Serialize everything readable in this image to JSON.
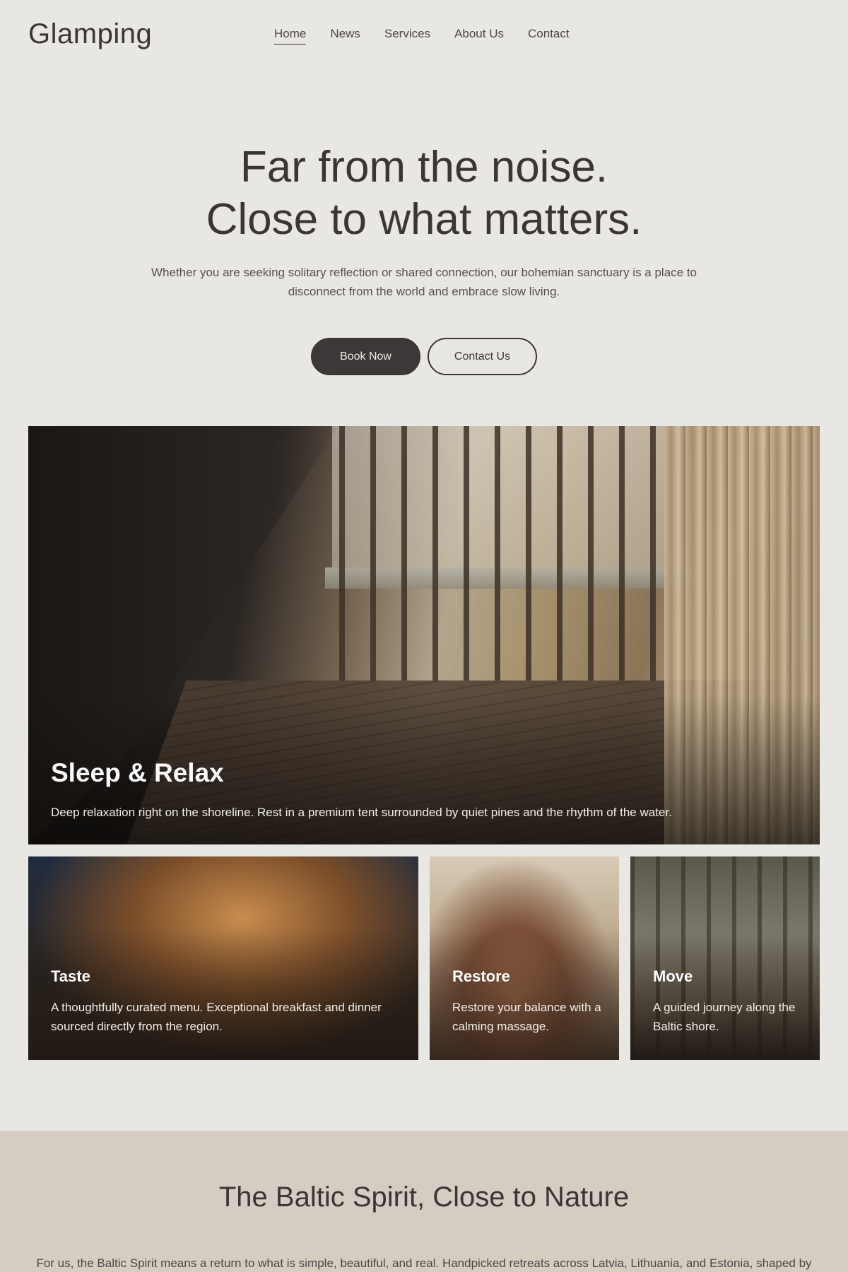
{
  "header": {
    "logo": "Glamping",
    "nav": [
      {
        "label": "Home",
        "active": true
      },
      {
        "label": "News"
      },
      {
        "label": "Services"
      },
      {
        "label": "About Us"
      },
      {
        "label": "Contact"
      }
    ]
  },
  "hero": {
    "title_line1": "Far from the noise.",
    "title_line2": "Close to what matters.",
    "subtitle": "Whether you are seeking solitary reflection or shared connection, our bohemian sanctuary is a place to disconnect from the world and embrace slow living.",
    "book_label": "Book Now",
    "contact_label": "Contact Us"
  },
  "cards": {
    "main": {
      "title": "Sleep & Relax",
      "text": "Deep relaxation right on the shoreline. Rest in a premium tent surrounded by quiet pines and the rhythm of the water."
    },
    "taste": {
      "title": "Taste",
      "text": "A thoughtfully curated menu. Exceptional breakfast and dinner sourced directly from the region."
    },
    "restore": {
      "title": "Restore",
      "text": "Restore your balance with a calming massage."
    },
    "move": {
      "title": "Move",
      "text": "A guided journey along the Baltic shore."
    }
  },
  "baltic": {
    "title": "The Baltic Spirit, Close to Nature",
    "text": "For us, the Baltic Spirit means a return to what is simple, beautiful, and real. Handpicked retreats across Latvia, Lithuania, and Estonia, shaped by"
  },
  "colors": {
    "background": "#e9e7e3",
    "text": "#3a3636",
    "button_dark": "#3d3838",
    "section_bg": "#d5cdc2"
  }
}
